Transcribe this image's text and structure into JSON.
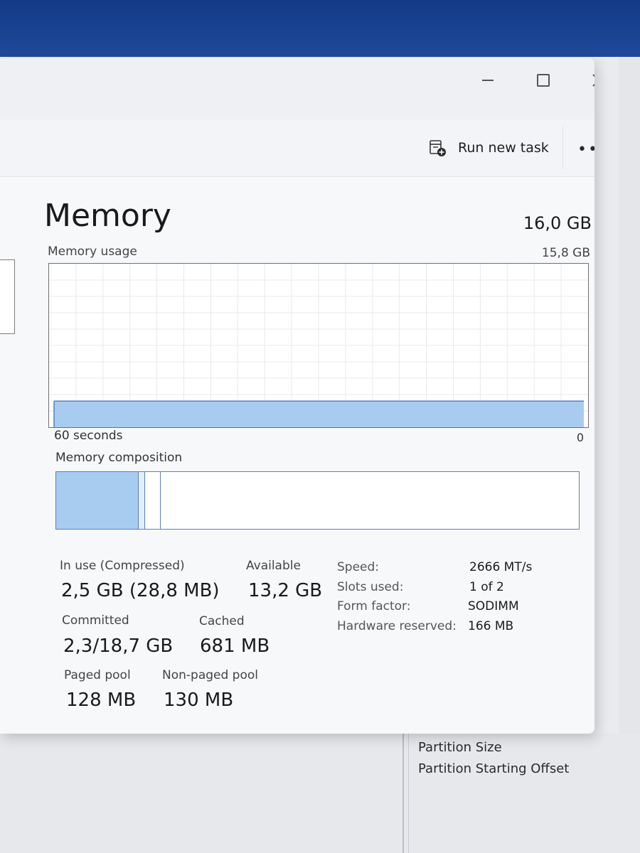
{
  "window": {
    "controls": {
      "minimize": "minimize",
      "maximize": "maximize",
      "close": "close"
    }
  },
  "toolbar": {
    "run_new_task": "Run new task",
    "more": "•••"
  },
  "memory": {
    "title": "Memory",
    "total": "16,0 GB",
    "usage_label": "Memory usage",
    "usage_max": "15,8 GB",
    "axis_left": "60 seconds",
    "axis_right": "0",
    "composition_label": "Memory composition",
    "usage_fraction": 0.16,
    "composition": {
      "in_use_fraction": 0.158,
      "modified_fraction": 0.012,
      "standby_fraction": 0.03
    }
  },
  "stats": {
    "in_use_label": "In use (Compressed)",
    "in_use_value": "2,5 GB (28,8 MB)",
    "available_label": "Available",
    "available_value": "13,2 GB",
    "committed_label": "Committed",
    "committed_value": "2,3/18,7 GB",
    "cached_label": "Cached",
    "cached_value": "681 MB",
    "paged_pool_label": "Paged pool",
    "paged_pool_value": "128 MB",
    "nonpaged_pool_label": "Non-paged pool",
    "nonpaged_pool_value": "130 MB"
  },
  "specs": [
    {
      "label": "Speed:",
      "value": "2666 MT/s"
    },
    {
      "label": "Slots used:",
      "value": "1 of 2"
    },
    {
      "label": "Form factor:",
      "value": "SODIMM"
    },
    {
      "label": "Hardware reserved:",
      "value": "166 MB"
    }
  ],
  "background_window": {
    "rows": [
      "Partition Size",
      "Partition Starting Offset"
    ]
  },
  "colors": {
    "accent_fill": "#a8ccf0",
    "accent_border": "#5b7fbe",
    "grid": "#e6e9ee"
  }
}
